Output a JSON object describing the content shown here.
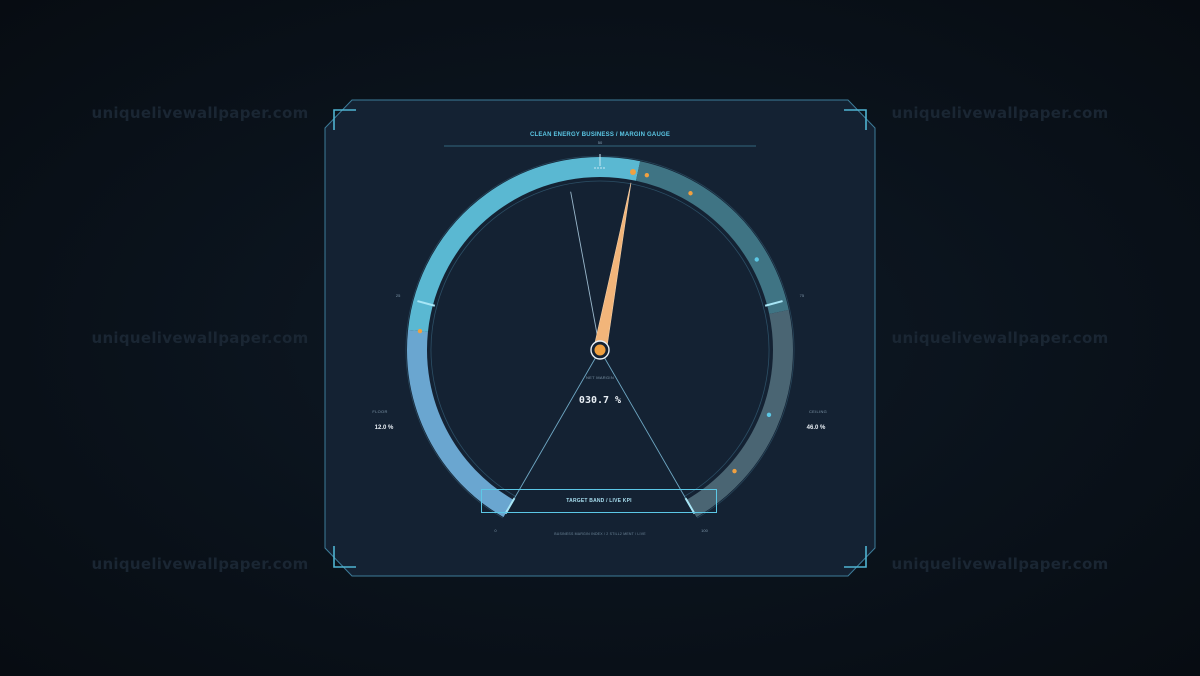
{
  "watermark": {
    "text": "uniquelivewallpaper.com"
  },
  "panel": {
    "title": "CLEAN ENERGY BUSINESS / MARGIN GAUGE",
    "top_tick_label": "50",
    "footer": "BUSINESS MARGIN INDEX / 2 STILL2 MENT / LIVE"
  },
  "gauge": {
    "scale_min": 0,
    "scale_max": 100,
    "needle_value": 53.5,
    "ghost_needle_value": 46.5,
    "scale_labels": {
      "min": "0",
      "q1": "25",
      "q3": "75",
      "max": "100"
    },
    "center_label": "NET MARGIN",
    "center_value": "030.7 %",
    "floor": {
      "label": "FLOOR",
      "value": "12.0 %"
    },
    "ceiling": {
      "label": "CEILING",
      "value": "46.0 %"
    },
    "bands": [
      {
        "from": 0,
        "to": 22,
        "color": "#6aa6d0"
      },
      {
        "from": 22,
        "to": 54,
        "color": "#5ab8d2"
      },
      {
        "from": 54,
        "to": 76,
        "color": "#3f7484"
      },
      {
        "from": 76,
        "to": 100,
        "color": "#4a6573"
      }
    ],
    "markers": [
      {
        "value": 22,
        "color": "#f0a040"
      },
      {
        "value": 55,
        "color": "#f0a040"
      },
      {
        "value": 60,
        "color": "#f0a040"
      },
      {
        "value": 70,
        "color": "#5cc8e6"
      },
      {
        "value": 87,
        "color": "#5cc8e6"
      },
      {
        "value": 94,
        "color": "#f0a040"
      }
    ]
  },
  "button": {
    "label": "TARGET BAND  /  LIVE KPI"
  },
  "colors": {
    "accent": "#5cc8e6",
    "panel_bg": "#142233",
    "needle": "#f2b57a",
    "needle_hub": "#f0a040"
  }
}
